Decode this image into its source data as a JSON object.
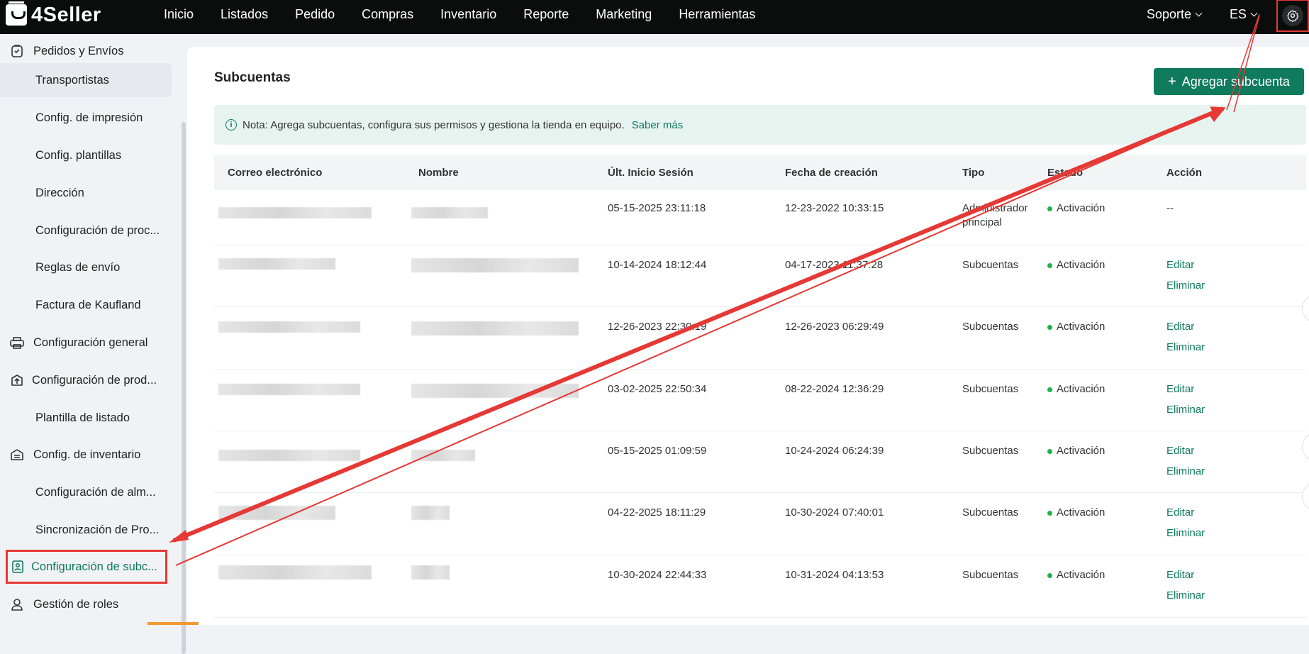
{
  "app": {
    "brand": "4Seller"
  },
  "topnav": {
    "items": [
      "Inicio",
      "Listados",
      "Pedido",
      "Compras",
      "Inventario",
      "Reporte",
      "Marketing",
      "Herramientas"
    ],
    "support": "Soporte",
    "language": "ES"
  },
  "sidebar": {
    "items": [
      {
        "label": "Pedidos y Envíos",
        "kind": "group",
        "icon": "order-icon"
      },
      {
        "label": "Transportistas",
        "kind": "sub",
        "selected": true
      },
      {
        "label": "Config. de impresión",
        "kind": "sub"
      },
      {
        "label": "Config. plantillas",
        "kind": "sub"
      },
      {
        "label": "Dirección",
        "kind": "sub"
      },
      {
        "label": "Configuración de proc...",
        "kind": "sub"
      },
      {
        "label": "Reglas de envío",
        "kind": "sub"
      },
      {
        "label": "Factura de Kaufland",
        "kind": "sub"
      },
      {
        "label": "Configuración general",
        "kind": "group",
        "icon": "printer-icon"
      },
      {
        "label": "Configuración de prod...",
        "kind": "group",
        "icon": "product-box-icon"
      },
      {
        "label": "Plantilla de listado",
        "kind": "sub"
      },
      {
        "label": "Config. de inventario",
        "kind": "group",
        "icon": "warehouse-icon"
      },
      {
        "label": "Configuración de alm...",
        "kind": "sub"
      },
      {
        "label": "Sincronización de Pro...",
        "kind": "sub"
      },
      {
        "label": "Configuración de subc...",
        "kind": "group",
        "icon": "subaccount-icon",
        "active": true
      },
      {
        "label": "Gestión de roles",
        "kind": "group",
        "icon": "user-icon"
      }
    ]
  },
  "main": {
    "title": "Subcuentas",
    "add_button": "Agregar subcuenta",
    "note": {
      "text": "Nota: Agrega subcuentas, configura sus permisos y gestiona la tienda en equipo.",
      "link": "Saber más"
    },
    "table": {
      "headers": [
        "Correo electrónico",
        "Nombre",
        "Últ. Inicio Sesión",
        "Fecha de creación",
        "Tipo",
        "Estado",
        "Acción"
      ],
      "rows": [
        {
          "last_login": "05-15-2025 23:11:18",
          "created": "12-23-2022 10:33:15",
          "type": "Administrador principal",
          "status": "Activación",
          "actions": [
            "--"
          ]
        },
        {
          "last_login": "10-14-2024 18:12:44",
          "created": "04-17-2023 11:37:28",
          "type": "Subcuentas",
          "status": "Activación",
          "actions": [
            "Editar",
            "Eliminar"
          ]
        },
        {
          "last_login": "12-26-2023 22:30:19",
          "created": "12-26-2023 06:29:49",
          "type": "Subcuentas",
          "status": "Activación",
          "actions": [
            "Editar",
            "Eliminar"
          ]
        },
        {
          "last_login": "03-02-2025 22:50:34",
          "created": "08-22-2024 12:36:29",
          "type": "Subcuentas",
          "status": "Activación",
          "actions": [
            "Editar",
            "Eliminar"
          ]
        },
        {
          "last_login": "05-15-2025 01:09:59",
          "created": "10-24-2024 06:24:39",
          "type": "Subcuentas",
          "status": "Activación",
          "actions": [
            "Editar",
            "Eliminar"
          ]
        },
        {
          "last_login": "04-22-2025 18:11:29",
          "created": "10-30-2024 07:40:01",
          "type": "Subcuentas",
          "status": "Activación",
          "actions": [
            "Editar",
            "Eliminar"
          ]
        },
        {
          "last_login": "10-30-2024 22:44:33",
          "created": "10-31-2024 04:13:53",
          "type": "Subcuentas",
          "status": "Activación",
          "actions": [
            "Editar",
            "Eliminar"
          ]
        }
      ]
    }
  },
  "colors": {
    "accent": "#0f7a5c",
    "topbar": "#0b0c0c",
    "annotation": "#e53935",
    "status_dot": "#22b14c"
  }
}
